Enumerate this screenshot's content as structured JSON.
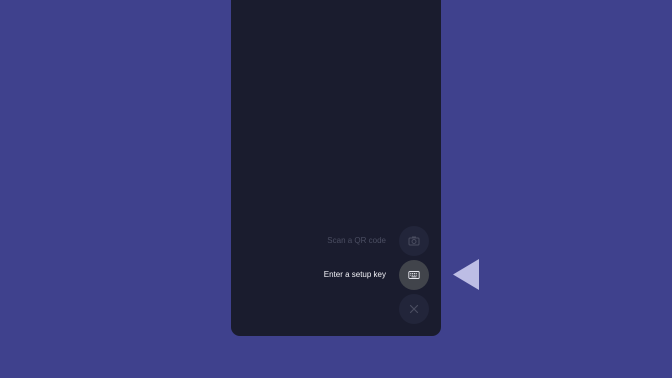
{
  "colors": {
    "background": "#3f418d",
    "phone_screen": "#1a1c2e",
    "active_fab": "#41444b",
    "dim_fab": "#22253a",
    "pointer": "#bdbde5"
  },
  "speed_dial": {
    "items": [
      {
        "label": "Scan a QR code",
        "icon": "camera-icon",
        "state": "dim"
      },
      {
        "label": "Enter a setup key",
        "icon": "keyboard-icon",
        "state": "active"
      }
    ],
    "close": {
      "icon": "close-icon",
      "state": "dim"
    }
  },
  "pointer": {
    "icon": "left-triangle-pointer-icon"
  }
}
